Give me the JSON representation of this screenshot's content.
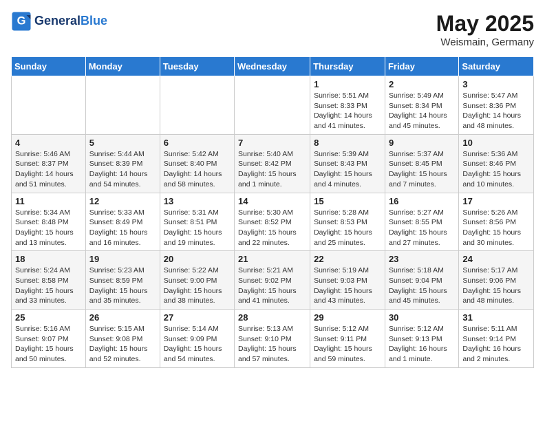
{
  "header": {
    "logo_line1": "General",
    "logo_line2": "Blue",
    "month": "May 2025",
    "location": "Weismain, Germany"
  },
  "weekdays": [
    "Sunday",
    "Monday",
    "Tuesday",
    "Wednesday",
    "Thursday",
    "Friday",
    "Saturday"
  ],
  "weeks": [
    [
      {
        "day": "",
        "info": ""
      },
      {
        "day": "",
        "info": ""
      },
      {
        "day": "",
        "info": ""
      },
      {
        "day": "",
        "info": ""
      },
      {
        "day": "1",
        "info": "Sunrise: 5:51 AM\nSunset: 8:33 PM\nDaylight: 14 hours\nand 41 minutes."
      },
      {
        "day": "2",
        "info": "Sunrise: 5:49 AM\nSunset: 8:34 PM\nDaylight: 14 hours\nand 45 minutes."
      },
      {
        "day": "3",
        "info": "Sunrise: 5:47 AM\nSunset: 8:36 PM\nDaylight: 14 hours\nand 48 minutes."
      }
    ],
    [
      {
        "day": "4",
        "info": "Sunrise: 5:46 AM\nSunset: 8:37 PM\nDaylight: 14 hours\nand 51 minutes."
      },
      {
        "day": "5",
        "info": "Sunrise: 5:44 AM\nSunset: 8:39 PM\nDaylight: 14 hours\nand 54 minutes."
      },
      {
        "day": "6",
        "info": "Sunrise: 5:42 AM\nSunset: 8:40 PM\nDaylight: 14 hours\nand 58 minutes."
      },
      {
        "day": "7",
        "info": "Sunrise: 5:40 AM\nSunset: 8:42 PM\nDaylight: 15 hours\nand 1 minute."
      },
      {
        "day": "8",
        "info": "Sunrise: 5:39 AM\nSunset: 8:43 PM\nDaylight: 15 hours\nand 4 minutes."
      },
      {
        "day": "9",
        "info": "Sunrise: 5:37 AM\nSunset: 8:45 PM\nDaylight: 15 hours\nand 7 minutes."
      },
      {
        "day": "10",
        "info": "Sunrise: 5:36 AM\nSunset: 8:46 PM\nDaylight: 15 hours\nand 10 minutes."
      }
    ],
    [
      {
        "day": "11",
        "info": "Sunrise: 5:34 AM\nSunset: 8:48 PM\nDaylight: 15 hours\nand 13 minutes."
      },
      {
        "day": "12",
        "info": "Sunrise: 5:33 AM\nSunset: 8:49 PM\nDaylight: 15 hours\nand 16 minutes."
      },
      {
        "day": "13",
        "info": "Sunrise: 5:31 AM\nSunset: 8:51 PM\nDaylight: 15 hours\nand 19 minutes."
      },
      {
        "day": "14",
        "info": "Sunrise: 5:30 AM\nSunset: 8:52 PM\nDaylight: 15 hours\nand 22 minutes."
      },
      {
        "day": "15",
        "info": "Sunrise: 5:28 AM\nSunset: 8:53 PM\nDaylight: 15 hours\nand 25 minutes."
      },
      {
        "day": "16",
        "info": "Sunrise: 5:27 AM\nSunset: 8:55 PM\nDaylight: 15 hours\nand 27 minutes."
      },
      {
        "day": "17",
        "info": "Sunrise: 5:26 AM\nSunset: 8:56 PM\nDaylight: 15 hours\nand 30 minutes."
      }
    ],
    [
      {
        "day": "18",
        "info": "Sunrise: 5:24 AM\nSunset: 8:58 PM\nDaylight: 15 hours\nand 33 minutes."
      },
      {
        "day": "19",
        "info": "Sunrise: 5:23 AM\nSunset: 8:59 PM\nDaylight: 15 hours\nand 35 minutes."
      },
      {
        "day": "20",
        "info": "Sunrise: 5:22 AM\nSunset: 9:00 PM\nDaylight: 15 hours\nand 38 minutes."
      },
      {
        "day": "21",
        "info": "Sunrise: 5:21 AM\nSunset: 9:02 PM\nDaylight: 15 hours\nand 41 minutes."
      },
      {
        "day": "22",
        "info": "Sunrise: 5:19 AM\nSunset: 9:03 PM\nDaylight: 15 hours\nand 43 minutes."
      },
      {
        "day": "23",
        "info": "Sunrise: 5:18 AM\nSunset: 9:04 PM\nDaylight: 15 hours\nand 45 minutes."
      },
      {
        "day": "24",
        "info": "Sunrise: 5:17 AM\nSunset: 9:06 PM\nDaylight: 15 hours\nand 48 minutes."
      }
    ],
    [
      {
        "day": "25",
        "info": "Sunrise: 5:16 AM\nSunset: 9:07 PM\nDaylight: 15 hours\nand 50 minutes."
      },
      {
        "day": "26",
        "info": "Sunrise: 5:15 AM\nSunset: 9:08 PM\nDaylight: 15 hours\nand 52 minutes."
      },
      {
        "day": "27",
        "info": "Sunrise: 5:14 AM\nSunset: 9:09 PM\nDaylight: 15 hours\nand 54 minutes."
      },
      {
        "day": "28",
        "info": "Sunrise: 5:13 AM\nSunset: 9:10 PM\nDaylight: 15 hours\nand 57 minutes."
      },
      {
        "day": "29",
        "info": "Sunrise: 5:12 AM\nSunset: 9:11 PM\nDaylight: 15 hours\nand 59 minutes."
      },
      {
        "day": "30",
        "info": "Sunrise: 5:12 AM\nSunset: 9:13 PM\nDaylight: 16 hours\nand 1 minute."
      },
      {
        "day": "31",
        "info": "Sunrise: 5:11 AM\nSunset: 9:14 PM\nDaylight: 16 hours\nand 2 minutes."
      }
    ]
  ]
}
